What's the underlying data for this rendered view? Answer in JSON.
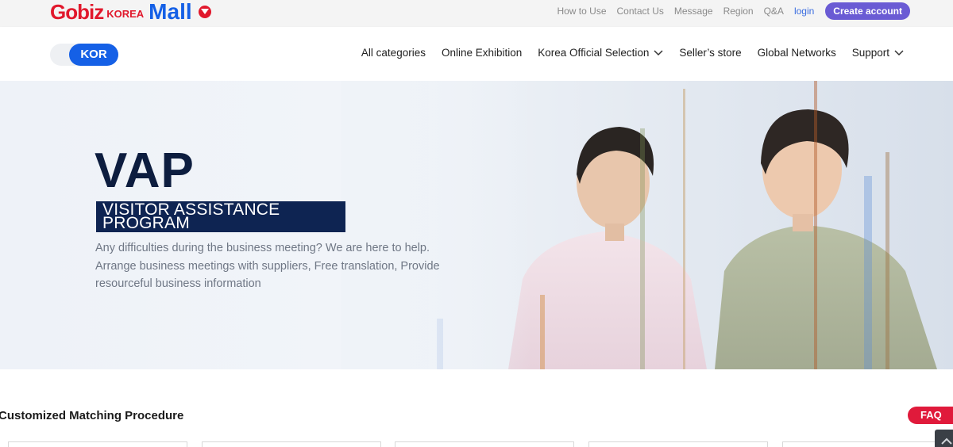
{
  "brand": {
    "logo_gobiz": "Gobiz",
    "logo_korea": "KOREA",
    "logo_mall": "Mall",
    "colors": {
      "red": "#e1182c",
      "blue": "#1560e6",
      "purple": "#6a5bd4",
      "navy": "#0e2452"
    }
  },
  "utility_links": [
    {
      "label": "How to Use"
    },
    {
      "label": "Contact Us"
    },
    {
      "label": "Message"
    },
    {
      "label": "Region"
    },
    {
      "label": "Q&A"
    },
    {
      "label": "login"
    }
  ],
  "create_account": "Create account",
  "language": {
    "selected": "KOR"
  },
  "nav": [
    {
      "label": "All categories",
      "has_dropdown": false
    },
    {
      "label": "Online Exhibition",
      "has_dropdown": false
    },
    {
      "label": "Korea Official Selection",
      "has_dropdown": true
    },
    {
      "label": "Seller’s store",
      "has_dropdown": false
    },
    {
      "label": "Global Networks",
      "has_dropdown": false
    },
    {
      "label": "Support",
      "has_dropdown": true
    }
  ],
  "hero": {
    "title": "VAP",
    "subtitle_line1": "VISITOR ASSISTANCE",
    "subtitle_line2": "PROGRAM",
    "description_line1": "Any difficulties during the business meeting? We are here to help.",
    "description_line2": "Arrange business meetings with suppliers, Free translation, Provide",
    "description_line3": "resourceful business information"
  },
  "section": {
    "title": "Customized Matching Procedure",
    "faq_label": "FAQ"
  },
  "icons": [
    "chevron-down-icon",
    "logo-badge-icon",
    "scroll-top-icon"
  ]
}
